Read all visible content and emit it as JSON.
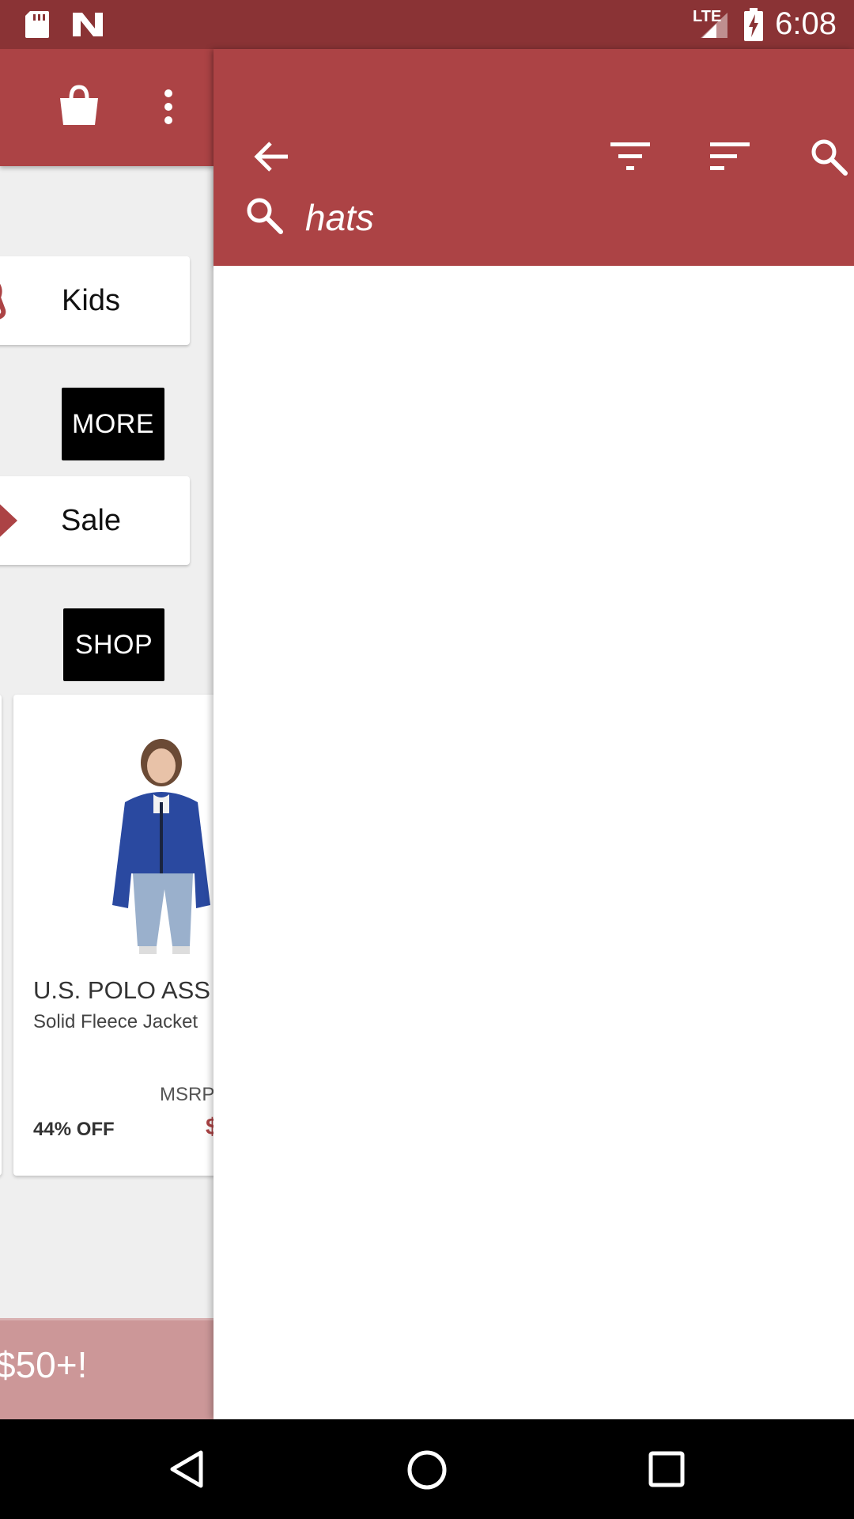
{
  "status_bar": {
    "time": "6:08",
    "network_label": "LTE",
    "icons": [
      "sd-card-icon",
      "n-notification-icon",
      "lte-signal-icon",
      "battery-charging-icon"
    ]
  },
  "background_screen": {
    "appbar_icons": [
      "shopping-bag-icon",
      "overflow-menu-icon"
    ],
    "categories": [
      {
        "label": "Kids",
        "icon": "kids-icon"
      },
      {
        "label": "Sale",
        "icon": "sale-tag-icon"
      }
    ],
    "buttons": {
      "more": "MORE",
      "shop": "SHOP"
    },
    "product": {
      "brand": "U.S. POLO ASS",
      "name": "Solid Fleece Jacket",
      "msrp_label": "MSRP",
      "discount": "44% OFF",
      "price_fragment": "$"
    },
    "promo_text": "$50+!"
  },
  "search_panel": {
    "toolbar_icons": [
      "back-arrow-icon",
      "filter-icon",
      "sort-icon",
      "search-icon"
    ],
    "query": "hats"
  },
  "colors": {
    "status_bar": "#8a3335",
    "toolbar": "#ac4345",
    "promo": "#cc9798",
    "background": "#efefef"
  },
  "nav_bar": {
    "icons": [
      "back-nav-icon",
      "home-nav-icon",
      "recents-nav-icon"
    ]
  }
}
